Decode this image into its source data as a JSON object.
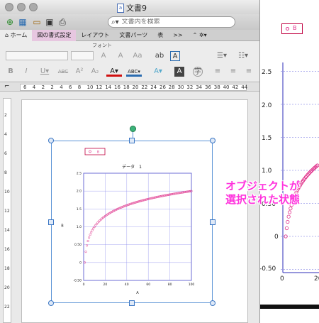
{
  "window": {
    "title": "文書9",
    "doc_icon": "a"
  },
  "toolbar": {
    "search_placeholder": "文書内を検索"
  },
  "ribbon_tabs": [
    "ホーム",
    "図の書式設定",
    "レイアウト",
    "文書パーツ",
    "表",
    ">>"
  ],
  "ribbon": {
    "group_label": "フォント",
    "font_size": ""
  },
  "ruler": {
    "marks": [
      "6",
      "4",
      "2",
      "2",
      "4",
      "6",
      "8",
      "10",
      "12",
      "14",
      "16",
      "18",
      "20",
      "22",
      "24",
      "26",
      "28",
      "30",
      "32",
      "34",
      "36",
      "38",
      "40",
      "42",
      "44"
    ],
    "v_marks": [
      "2",
      "4",
      "6",
      "8",
      "10",
      "12",
      "14",
      "16",
      "18",
      "20",
      "22"
    ]
  },
  "annotation": {
    "line1": "オブジェクトが",
    "line2": "選択された状態"
  },
  "bg_chart": {
    "legend": "B",
    "ticks": [
      "2.5",
      "2.0",
      "1.5",
      "1.0",
      "0.50",
      "0",
      "-0.50"
    ],
    "x_ticks": [
      "0",
      "20"
    ]
  },
  "chart_data": {
    "type": "scatter",
    "title": "データ　1",
    "xlabel": "A",
    "ylabel": "B",
    "xlim": [
      0,
      100
    ],
    "ylim": [
      -0.5,
      2.5
    ],
    "x_ticks": [
      0,
      20,
      40,
      60,
      80,
      100
    ],
    "y_ticks": [
      -0.5,
      0,
      0.5,
      1.0,
      1.5,
      2.0,
      2.5
    ],
    "y_tick_labels": [
      "-0.50",
      "0",
      "0.50",
      "1.0",
      "1.5",
      "2.0",
      "2.5"
    ],
    "grid": true,
    "legend": {
      "position": "top-left",
      "entries": [
        "B"
      ]
    },
    "marker_color": "#e0308a",
    "series": [
      {
        "name": "B",
        "function": "log10(x)",
        "x_start": 1,
        "x_end": 100
      }
    ]
  }
}
